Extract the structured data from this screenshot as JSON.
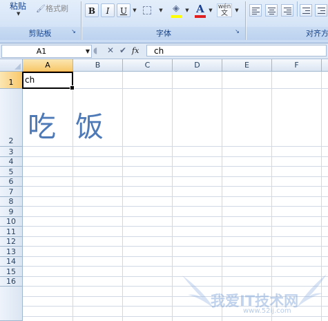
{
  "ribbon": {
    "clipboard": {
      "paste_label": "粘贴",
      "format_painter_label": "格式刷",
      "group_label": "剪贴板"
    },
    "font": {
      "bold_label": "B",
      "italic_label": "I",
      "underline_label": "U",
      "font_color_label": "A",
      "phonetic_label": "wén",
      "phonetic_char": "文",
      "group_label": "字体",
      "fill_color": "#ffff00",
      "font_color": "#e02020"
    },
    "alignment": {
      "group_label": "对齐方式"
    }
  },
  "formula_bar": {
    "name_box": "A1",
    "fx_label": "fx",
    "content": "ch"
  },
  "sheet": {
    "columns": [
      "A",
      "B",
      "C",
      "D",
      "E",
      "F"
    ],
    "rows": [
      "1",
      "2",
      "3",
      "4",
      "5",
      "6",
      "7",
      "8",
      "9",
      "10",
      "11",
      "12",
      "13",
      "14",
      "15",
      "16"
    ],
    "selected_column": "A",
    "selected_row": "1",
    "cell_a1": "ch",
    "large_text": "吃饭",
    "large_text_color": "#4f7ab8"
  },
  "watermark": {
    "text": "我爱IT技术网",
    "url": "www.52ij.com"
  }
}
